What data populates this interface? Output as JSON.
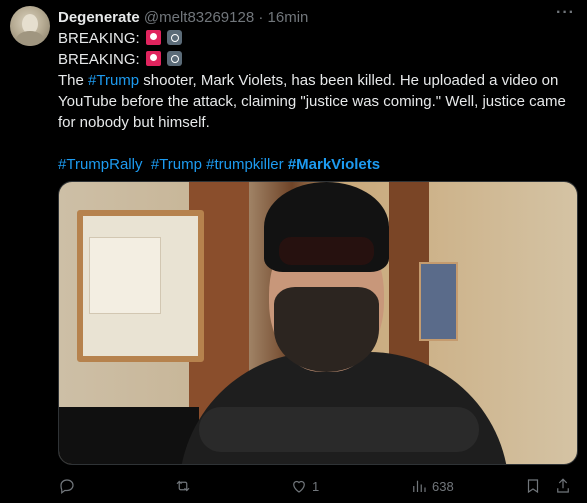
{
  "author": {
    "name": "Degenerate",
    "handle": "@melt83269128",
    "separator": "·",
    "time": "16min"
  },
  "more_label": "···",
  "body": {
    "line1_prefix": "BREAKING:",
    "line2_prefix": "BREAKING:",
    "paragraph_before_tag": "The ",
    "paragraph_tag": "#Trump",
    "paragraph_after_tag": " shooter, Mark Violets, has been killed.   He uploaded a video on YouTube before the attack, claiming \"justice was coming.\"  Well, justice came for nobody but himself.",
    "hashtags": [
      "#TrumpRally",
      "#Trump",
      "#trumpkiller",
      "#MarkViolets"
    ]
  },
  "emoji": [
    "siren-emoji",
    "camera-emoji"
  ],
  "actions": {
    "reply_count": "",
    "repost_count": "",
    "like_count": "1",
    "views_count": "638"
  },
  "colors": {
    "link": "#1d9bf0",
    "text": "#e7e9ea",
    "muted": "#71767b",
    "background": "#000000"
  }
}
